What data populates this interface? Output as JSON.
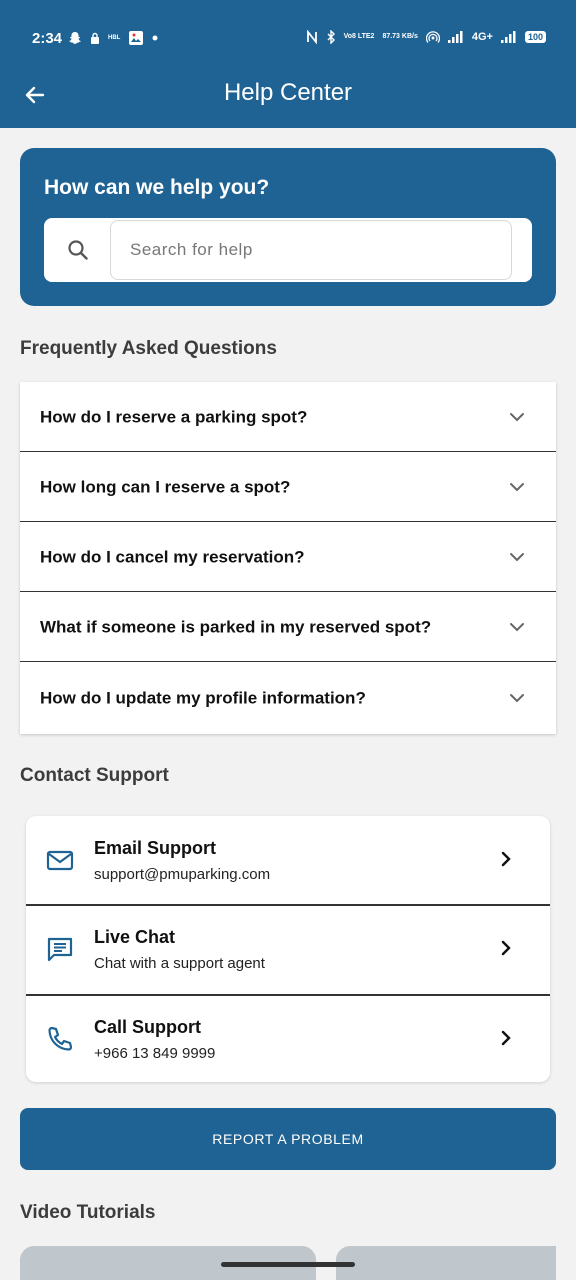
{
  "status_bar": {
    "time": "2:34",
    "left_icons": [
      "snapchat-icon",
      "lock-icon",
      "hbl-icon",
      "photos-icon",
      "dot-icon"
    ],
    "hbl_text": "HBL",
    "volte": "Vo8 LTE2",
    "speed": "87.73 KB/s",
    "network": "4G+",
    "battery": "100"
  },
  "app_bar": {
    "title": "Help Center",
    "back_icon": "arrow-left-icon"
  },
  "hero": {
    "title": "How can we help you?",
    "search_placeholder": "Search for help",
    "search_value": ""
  },
  "faq": {
    "title": "Frequently Asked Questions",
    "items": [
      {
        "question": "How do I reserve a parking spot?"
      },
      {
        "question": "How long can I reserve a spot?"
      },
      {
        "question": "How do I cancel my reservation?"
      },
      {
        "question": "What if someone is parked in my reserved spot?"
      },
      {
        "question": "How do I update my profile information?"
      }
    ]
  },
  "contact": {
    "title": "Contact Support",
    "items": [
      {
        "icon": "mail-icon",
        "title": "Email Support",
        "subtitle": "support@pmuparking.com"
      },
      {
        "icon": "chat-icon",
        "title": "Live Chat",
        "subtitle": "Chat with a support agent"
      },
      {
        "icon": "phone-icon",
        "title": "Call Support",
        "subtitle": "+966 13 849 9999"
      }
    ]
  },
  "report_button": {
    "label": "REPORT A PROBLEM"
  },
  "videos": {
    "title": "Video Tutorials"
  },
  "colors": {
    "primary": "#1f6394",
    "background": "#f2f2f2",
    "card": "#ffffff",
    "placeholder_thumb": "#bfc6cc"
  }
}
